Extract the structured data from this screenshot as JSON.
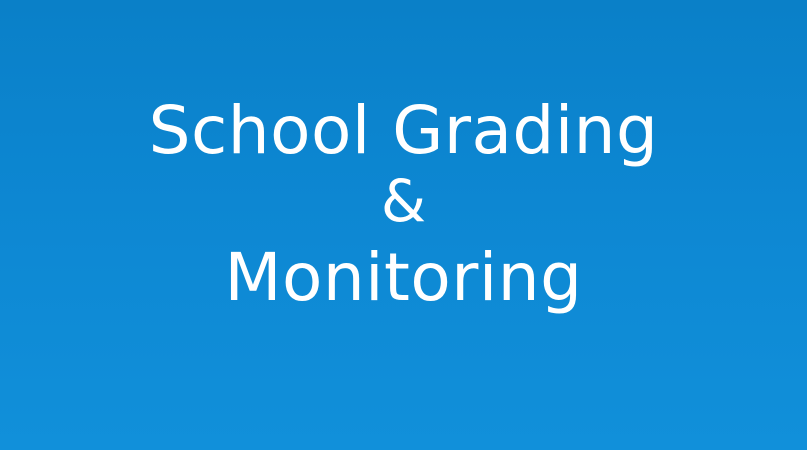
{
  "banner": {
    "line1": "School Grading",
    "line2": "&",
    "line3": "Monitoring"
  },
  "colors": {
    "background": "#0d87d2",
    "text": "#ffffff"
  }
}
